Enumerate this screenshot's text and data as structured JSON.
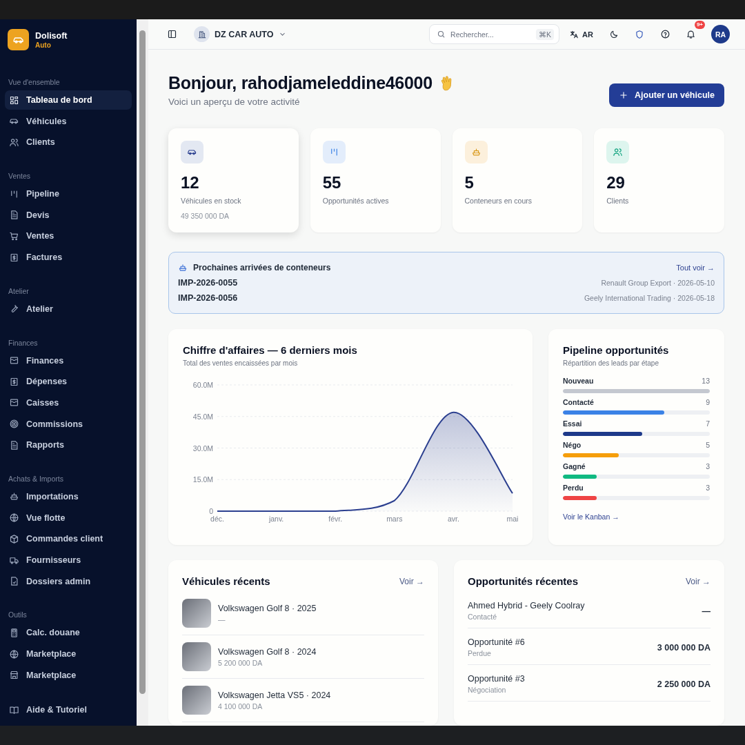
{
  "brand": {
    "name": "Dolisoft",
    "subtitle": "Auto"
  },
  "sidebar": {
    "sections": [
      {
        "heading": "Vue d'ensemble",
        "items": [
          {
            "label": "Tableau de bord",
            "selected": true
          },
          {
            "label": "Véhicules",
            "selected": false
          },
          {
            "label": "Clients",
            "selected": false
          }
        ]
      },
      {
        "heading": "Ventes",
        "items": [
          {
            "label": "Pipeline",
            "selected": false
          },
          {
            "label": "Devis",
            "selected": false
          },
          {
            "label": "Ventes",
            "selected": false
          },
          {
            "label": "Factures",
            "selected": false
          }
        ]
      },
      {
        "heading": "Atelier",
        "items": [
          {
            "label": "Atelier",
            "selected": false
          }
        ]
      },
      {
        "heading": "Finances",
        "items": [
          {
            "label": "Finances",
            "selected": false
          },
          {
            "label": "Dépenses",
            "selected": false
          },
          {
            "label": "Caisses",
            "selected": false
          },
          {
            "label": "Commissions",
            "selected": false
          },
          {
            "label": "Rapports",
            "selected": false
          }
        ]
      },
      {
        "heading": "Achats & Imports",
        "items": [
          {
            "label": "Importations",
            "selected": false
          },
          {
            "label": "Vue flotte",
            "selected": false
          },
          {
            "label": "Commandes client",
            "selected": false
          },
          {
            "label": "Fournisseurs",
            "selected": false
          },
          {
            "label": "Dossiers admin",
            "selected": false
          }
        ]
      },
      {
        "heading": "Outils",
        "items": [
          {
            "label": "Calc. douane",
            "selected": false
          },
          {
            "label": "Marketplace",
            "selected": false
          },
          {
            "label": "Marketplace",
            "selected": false
          }
        ]
      }
    ],
    "footer_item": {
      "label": "Aide & Tutoriel",
      "selected": false
    }
  },
  "topbar": {
    "company": "DZ CAR AUTO",
    "search": {
      "placeholder": "Rechercher...",
      "shortcut": "⌘K"
    },
    "language": "AR",
    "notifications_badge": "9+",
    "avatar": "RA"
  },
  "greeting": {
    "title": "Bonjour, rahodjameleddine46000",
    "subtitle": "Voici un aperçu de votre activité"
  },
  "add_button": "Ajouter un véhicule",
  "stats": [
    {
      "value": "12",
      "label": "Véhicules en stock",
      "detail": "49 350 000 DA"
    },
    {
      "value": "55",
      "label": "Opportunités actives"
    },
    {
      "value": "5",
      "label": "Conteneurs en cours"
    },
    {
      "value": "29",
      "label": "Clients"
    }
  ],
  "containers": {
    "title": "Prochaines arrivées de conteneurs",
    "link": "Tout voir →",
    "rows": [
      {
        "ref": "IMP-2026-0055",
        "info": "Renault Group Export · 2026-05-10"
      },
      {
        "ref": "IMP-2026-0056",
        "info": "Geely International Trading · 2026-05-18"
      }
    ]
  },
  "revenue": {
    "title": "Chiffre d'affaires — 6 derniers mois",
    "subtitle": "Total des ventes encaissées par mois",
    "chart_data": {
      "type": "area",
      "categories": [
        "déc.",
        "janv.",
        "févr.",
        "mars",
        "avr.",
        "mai"
      ],
      "series": [
        {
          "color": "#2b3f8f",
          "values": [
            0,
            0,
            0,
            5,
            47,
            8.5
          ]
        }
      ],
      "grid": true,
      "ylim": [
        0,
        60
      ],
      "yticks": [
        {
          "value": 0,
          "label": "0"
        },
        {
          "value": 15,
          "label": "15.0M"
        },
        {
          "value": 30,
          "label": "30.0M"
        },
        {
          "value": 45,
          "label": "45.0M"
        },
        {
          "value": 60,
          "label": "60.0M"
        }
      ]
    }
  },
  "pipeline": {
    "title": "Pipeline opportunités",
    "subtitle": "Répartition des leads par étape",
    "stages": [
      {
        "label": "Nouveau",
        "count": "13",
        "level": 1,
        "color": "#c4c8d0"
      },
      {
        "label": "Contacté",
        "count": "9",
        "level": 0.69,
        "color": "#3b82e6"
      },
      {
        "label": "Essai",
        "count": "7",
        "level": 0.54,
        "color": "#1e3a8a"
      },
      {
        "label": "Négo",
        "count": "5",
        "level": 0.38,
        "color": "#f59e0b"
      },
      {
        "label": "Gagné",
        "count": "3",
        "level": 0.23,
        "color": "#10b981"
      },
      {
        "label": "Perdu",
        "count": "3",
        "level": 0.23,
        "color": "#ef4444"
      }
    ],
    "link": "Voir le Kanban →"
  },
  "recent_vehicles": {
    "title": "Véhicules récents",
    "link": "Voir →",
    "items": [
      {
        "name": "Volkswagen Golf 8 · 2025",
        "price": "—"
      },
      {
        "name": "Volkswagen Golf 8 · 2024",
        "price": "5 200 000 DA"
      },
      {
        "name": "Volkswagen Jetta VS5 · 2024",
        "price": "4 100 000 DA"
      }
    ]
  },
  "recent_opportunities": {
    "title": "Opportunités récentes",
    "link": "Voir →",
    "items": [
      {
        "name": "Ahmed Hybrid - Geely Coolray",
        "status": "Contacté",
        "amount": "—"
      },
      {
        "name": "Opportunité #6",
        "status": "Perdue",
        "amount": "3 000 000 DA"
      },
      {
        "name": "Opportunité #3",
        "status": "Négociation",
        "amount": "2 250 000 DA"
      }
    ]
  }
}
